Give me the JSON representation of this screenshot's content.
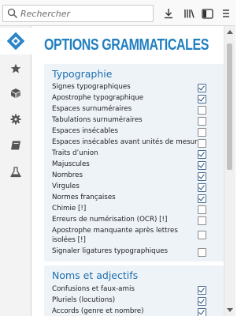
{
  "toolbar": {
    "search_placeholder": "Rechercher",
    "icons": [
      "search-icon",
      "download-icon",
      "library-icon",
      "sidebar-icon",
      "menu-icon"
    ]
  },
  "sidebar": {
    "items": [
      {
        "name": "grammalecte-logo",
        "active": true
      },
      {
        "name": "star-icon"
      },
      {
        "name": "cube-icon"
      },
      {
        "name": "gear-icon"
      },
      {
        "name": "book-icon"
      },
      {
        "name": "flask-icon"
      }
    ]
  },
  "main": {
    "title": "OPTIONS GRAMMATICALES",
    "sections": [
      {
        "title": "Typographie",
        "options": [
          {
            "label": "Signes typographiques",
            "checked": true
          },
          {
            "label": "Apostrophe typographique",
            "checked": true
          },
          {
            "label": "Espaces surnuméraires",
            "checked": false
          },
          {
            "label": "Tabulations surnuméraires",
            "checked": false
          },
          {
            "label": "Espaces insécables",
            "checked": false
          },
          {
            "label": "Espaces insécables avant unités de mesure",
            "checked": false
          },
          {
            "label": "Traits d’union",
            "checked": true
          },
          {
            "label": "Majuscules",
            "checked": true
          },
          {
            "label": "Nombres",
            "checked": true
          },
          {
            "label": "Virgules",
            "checked": true
          },
          {
            "label": "Normes françaises",
            "checked": true
          },
          {
            "label": "Chimie [!]",
            "checked": false
          },
          {
            "label": "Erreurs de numérisation (OCR) [!]",
            "checked": false
          },
          {
            "label": "Apostrophe manquante après lettres isolées [!]",
            "checked": false
          },
          {
            "label": "Signaler ligatures typographiques",
            "checked": false
          }
        ]
      },
      {
        "title": "Noms et adjectifs",
        "options": [
          {
            "label": "Confusions et faux-amis",
            "checked": true
          },
          {
            "label": "Pluriels (locutions)",
            "checked": true
          },
          {
            "label": "Accords (genre et nombre)",
            "checked": true
          }
        ]
      }
    ]
  },
  "colors": {
    "title": "#1f7fc1",
    "section_title": "#1d6fae",
    "section_bg": "#eef3f8"
  }
}
